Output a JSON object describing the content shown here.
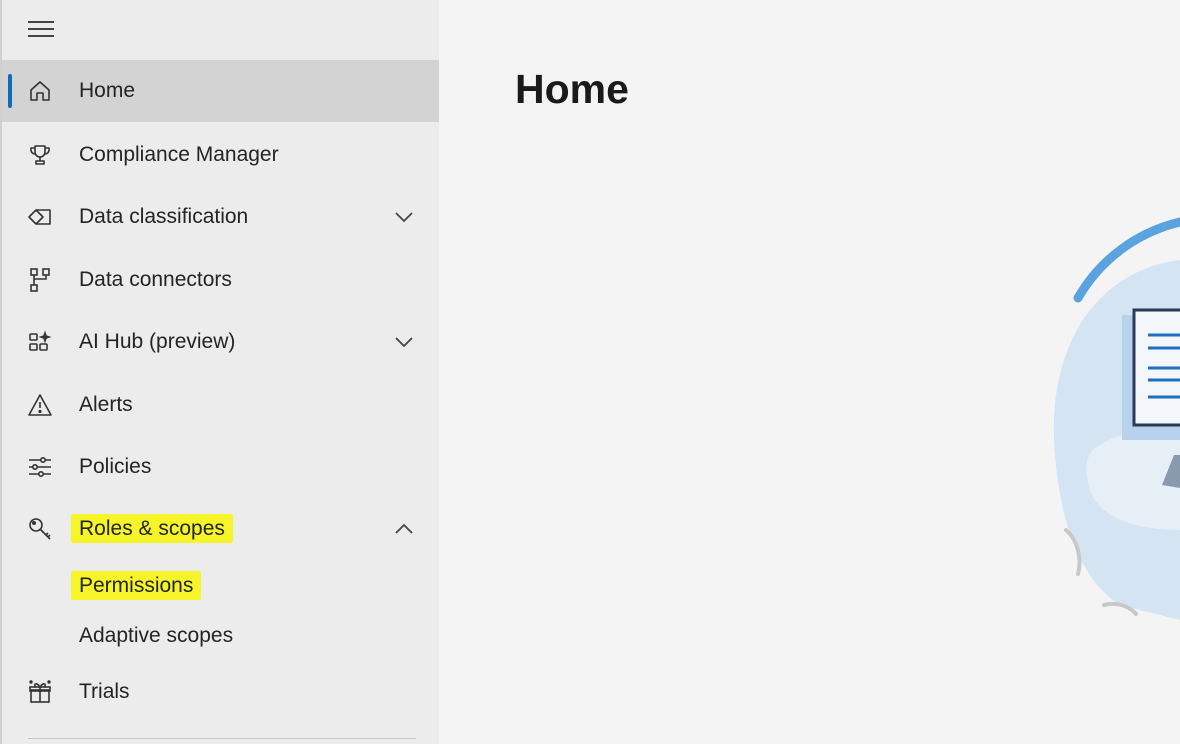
{
  "sidebar": {
    "menu_icon": "hamburger-icon",
    "items": [
      {
        "label": "Home",
        "icon": "home-icon"
      },
      {
        "label": "Compliance Manager",
        "icon": "trophy-icon"
      },
      {
        "label": "Data classification",
        "icon": "tag-icon"
      },
      {
        "label": "Data connectors",
        "icon": "connector-icon"
      },
      {
        "label": "AI Hub (preview)",
        "icon": "ai-hub-icon"
      },
      {
        "label": "Alerts",
        "icon": "warning-icon"
      },
      {
        "label": "Policies",
        "icon": "sliders-icon"
      },
      {
        "label": "Roles & scopes",
        "icon": "key-icon"
      },
      {
        "label": "Trials",
        "icon": "gift-icon"
      }
    ],
    "sub_items": [
      {
        "label": "Permissions"
      },
      {
        "label": "Adaptive scopes"
      }
    ],
    "active_item": "Home",
    "highlight_color": "#f5f52a",
    "accent_color": "#0f6cbd"
  },
  "main": {
    "title": "Home",
    "illustration": "compliance-illustration"
  }
}
